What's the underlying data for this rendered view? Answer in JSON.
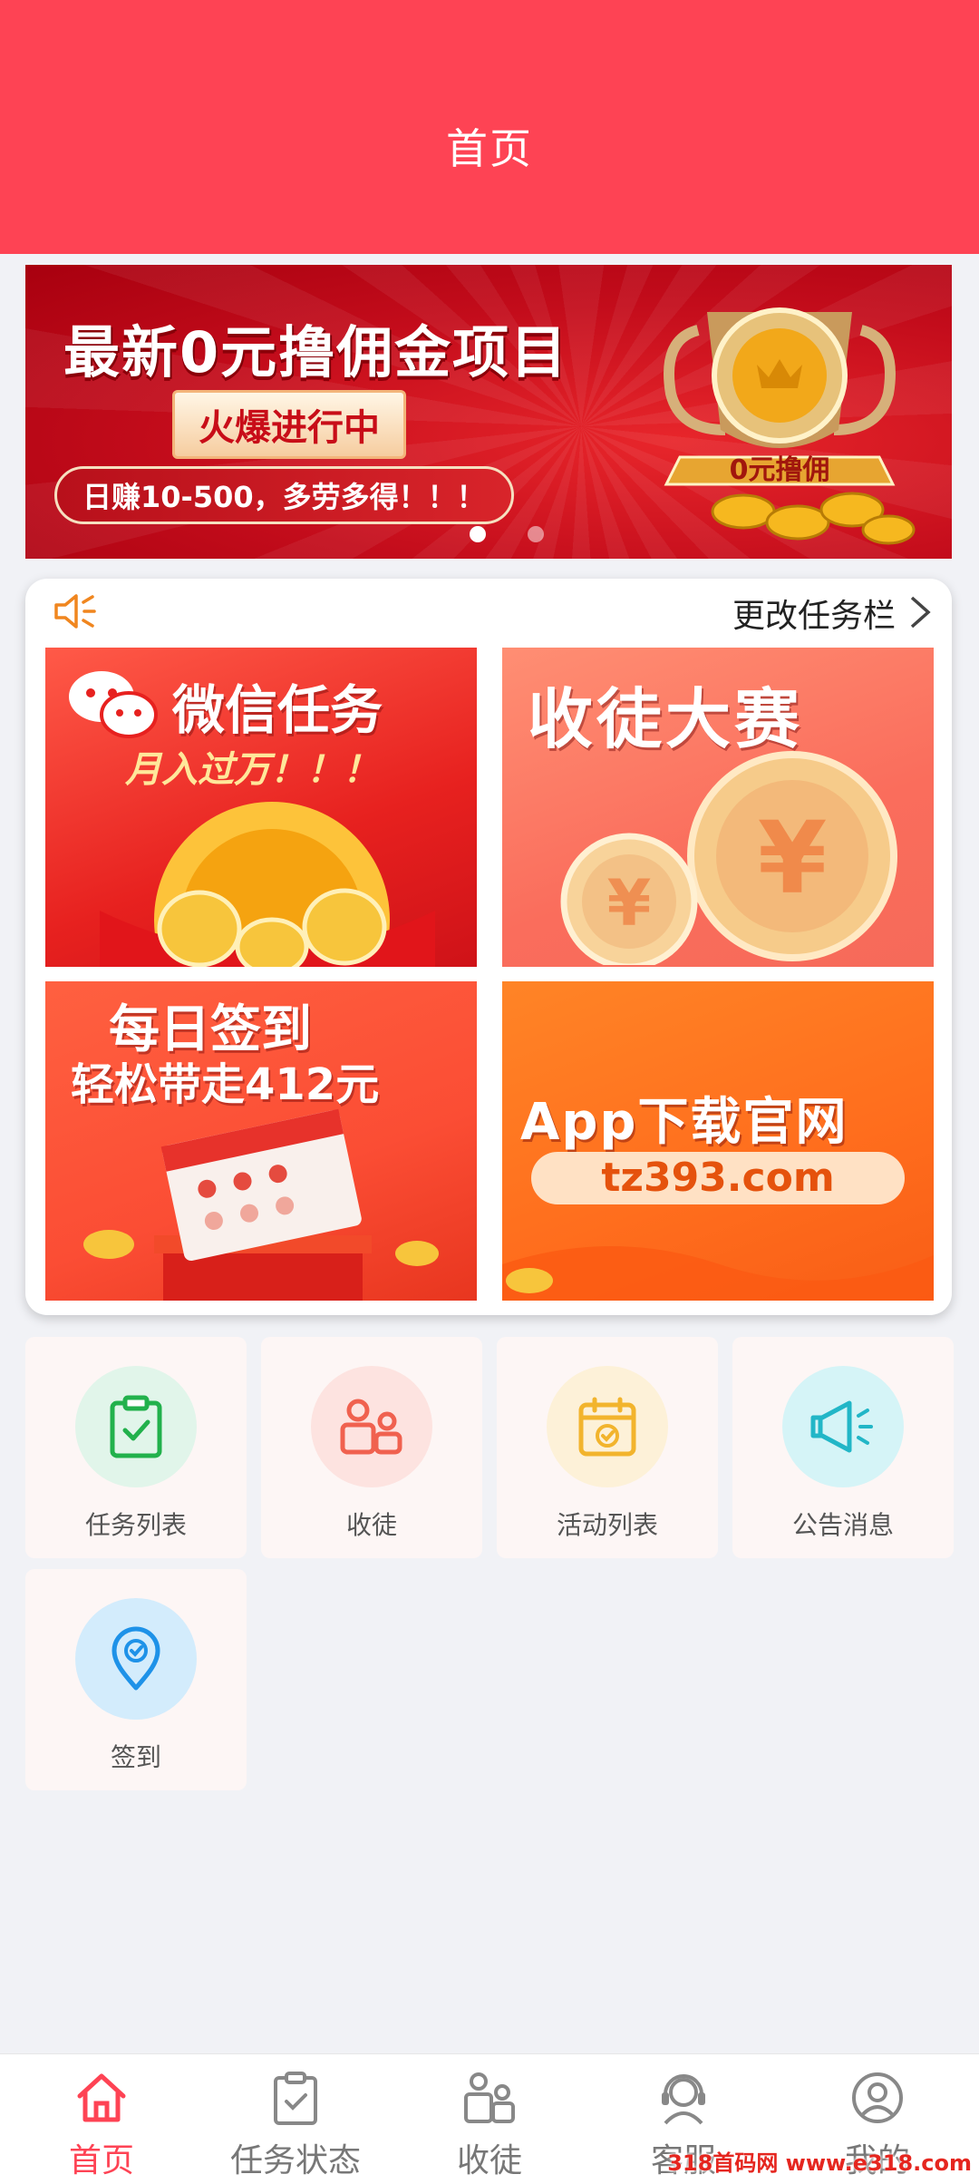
{
  "header": {
    "title": "首页"
  },
  "banner": {
    "headline": "最新0元撸佣金项目",
    "status": "火爆进行中",
    "pill": "日赚10-500，多劳多得！！！",
    "badge": "0元撸佣",
    "active_slide": 1,
    "slide_count": 2
  },
  "notice": {
    "text": "更改任务栏"
  },
  "tiles": [
    {
      "title": "微信任务",
      "subtitle": "月入过万！！！"
    },
    {
      "title": "收徒大赛"
    },
    {
      "title": "每日签到",
      "subtitle": "轻松带走412元"
    },
    {
      "title": "App下载官网",
      "url": "tz393.com"
    }
  ],
  "menu": [
    {
      "label": "任务列表",
      "icon": "clipboard-check-icon",
      "color": "#22b14c",
      "bg": "#e1f5ea"
    },
    {
      "label": "收徒",
      "icon": "users-icon",
      "color": "#f0614f",
      "bg": "#fde3e0"
    },
    {
      "label": "活动列表",
      "icon": "calendar-check-icon",
      "color": "#f2b42d",
      "bg": "#fdf1d8"
    },
    {
      "label": "公告消息",
      "icon": "megaphone-icon",
      "color": "#22b6c7",
      "bg": "#d5f4f7"
    },
    {
      "label": "签到",
      "icon": "location-check-icon",
      "color": "#1e92e8",
      "bg": "#d3ecfc"
    }
  ],
  "nav": [
    {
      "label": "首页",
      "icon": "home-icon",
      "active": true
    },
    {
      "label": "任务状态",
      "icon": "clipboard-check-icon"
    },
    {
      "label": "收徒",
      "icon": "users-icon"
    },
    {
      "label": "客服",
      "icon": "headset-icon"
    },
    {
      "label": "我的",
      "icon": "user-circle-icon"
    }
  ],
  "colors": {
    "primary": "#fe4354",
    "page_bg": "#f1f2f6"
  },
  "watermark": "318首码网 www.e318.com"
}
